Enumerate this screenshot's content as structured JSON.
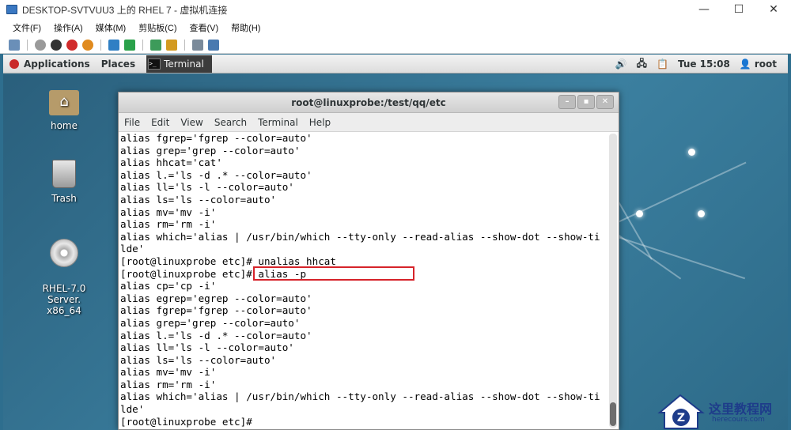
{
  "host_window": {
    "title": "DESKTOP-SVTVUU3 上的 RHEL 7 - 虚拟机连接",
    "controls": [
      "—",
      "☐",
      "✕"
    ],
    "menu": [
      "文件(F)",
      "操作(A)",
      "媒体(M)",
      "剪贴板(C)",
      "查看(V)",
      "帮助(H)"
    ]
  },
  "gnome_bar": {
    "applications": "Applications",
    "places": "Places",
    "task_label": "Terminal",
    "volume_icon": "🔊",
    "network_icon": "🖧",
    "clipboard_icon": "📋",
    "clock": "Tue 15:08",
    "user_icon": "👤",
    "user": "root"
  },
  "desktop_icons": [
    {
      "label": "home"
    },
    {
      "label": "Trash"
    },
    {
      "label": "RHEL-7.0 Server.\nx86_64"
    }
  ],
  "terminal": {
    "title": "root@linuxprobe:/test/qq/etc",
    "buttons": [
      "–",
      "▪",
      "✕"
    ],
    "menu": [
      "File",
      "Edit",
      "View",
      "Search",
      "Terminal",
      "Help"
    ],
    "lines": [
      "alias fgrep='fgrep --color=auto'",
      "alias grep='grep --color=auto'",
      "alias hhcat='cat'",
      "alias l.='ls -d .* --color=auto'",
      "alias ll='ls -l --color=auto'",
      "alias ls='ls --color=auto'",
      "alias mv='mv -i'",
      "alias rm='rm -i'",
      "alias which='alias | /usr/bin/which --tty-only --read-alias --show-dot --show-ti",
      "lde'",
      "[root@linuxprobe etc]# unalias hhcat",
      "[root@linuxprobe etc]# alias -p",
      "alias cp='cp -i'",
      "alias egrep='egrep --color=auto'",
      "alias fgrep='fgrep --color=auto'",
      "alias grep='grep --color=auto'",
      "alias l.='ls -d .* --color=auto'",
      "alias ll='ls -l --color=auto'",
      "alias ls='ls --color=auto'",
      "alias mv='mv -i'",
      "alias rm='rm -i'",
      "alias which='alias | /usr/bin/which --tty-only --read-alias --show-dot --show-ti",
      "lde'",
      "[root@linuxprobe etc]# "
    ]
  },
  "watermark": {
    "text": "这里教程网",
    "url": "herecours.com"
  },
  "colors": {
    "highlight": "#d6232a",
    "desktop": "#2e6e8e"
  }
}
